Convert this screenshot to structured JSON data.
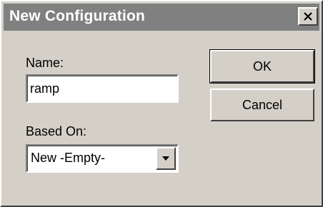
{
  "window": {
    "title": "New Configuration",
    "close_icon": "close-icon"
  },
  "form": {
    "name_label": "Name:",
    "name_value": "ramp",
    "based_on_label": "Based On:",
    "based_on_value": "New -Empty-",
    "dropdown_icon": "chevron-down-icon"
  },
  "buttons": {
    "ok_label": "OK",
    "cancel_label": "Cancel"
  },
  "colors": {
    "dialog_face": "#d4d0c8",
    "titlebar": "#808080",
    "title_text": "#ffffff"
  }
}
